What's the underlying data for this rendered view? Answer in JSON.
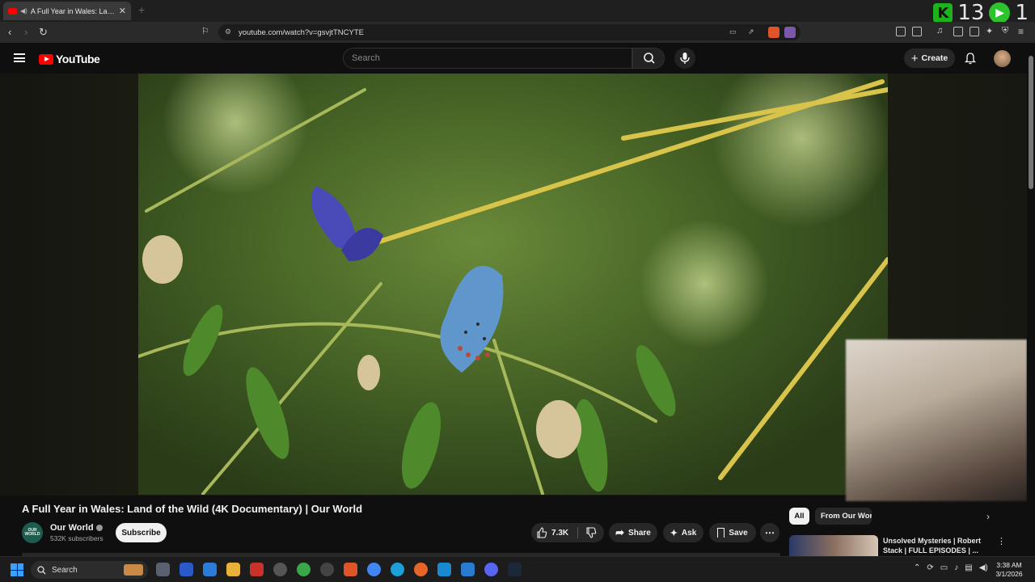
{
  "browser": {
    "tab_title": "A Full Year in Wales: Land of t",
    "new_tab": "+",
    "url": "youtube.com/watch?v=gsvjtTNCYTE",
    "overlay_counter_left": "13",
    "overlay_counter_right": "1"
  },
  "header": {
    "logo_text": "YouTube",
    "search_placeholder": "Search",
    "create_label": "Create"
  },
  "video": {
    "title": "A Full Year in Wales: Land of the Wild (4K Documentary) | Our World",
    "channel_name": "Our World",
    "channel_avatar_text": "OUR WORLD",
    "subscribers": "532K subscribers",
    "subscribe_label": "Subscribe",
    "like_count": "7.3K",
    "share_label": "Share",
    "ask_label": "Ask",
    "save_label": "Save"
  },
  "sidebar": {
    "chips": [
      "All",
      "From Our World"
    ],
    "recommendation_title": "Unsolved Mysteries | Robert Stack | FULL EPISODES | ..."
  },
  "taskbar": {
    "search_label": "Search",
    "time": "3:38 AM",
    "date": "3/1/2026"
  },
  "colors": {
    "youtube_red": "#ff0000",
    "background": "#0f0f0f",
    "pill": "#272727"
  }
}
